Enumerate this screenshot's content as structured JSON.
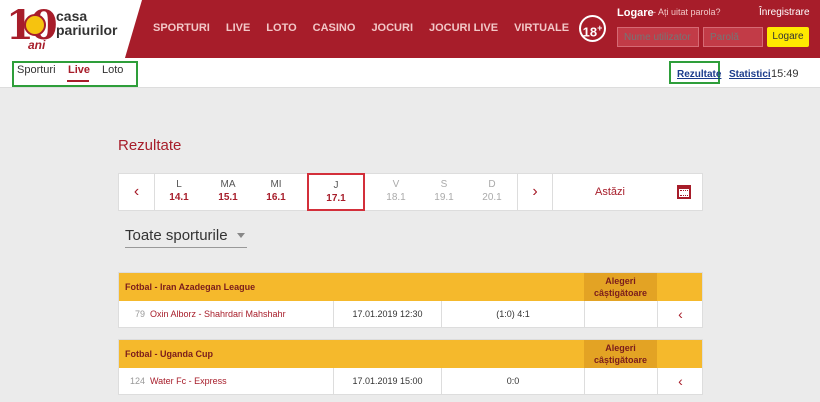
{
  "header": {
    "logo_number": "10",
    "logo_ani": "ani",
    "logo_text": "casa pariurilor",
    "nav": [
      "SPORTURI",
      "LIVE",
      "LOTO",
      "CASINO",
      "JOCURI",
      "JOCURI LIVE",
      "VIRTUALE"
    ],
    "age_badge": "18",
    "age_plus": "+",
    "login_title": "Logare",
    "forgot_password": "- Ați uitat parola?",
    "register": "Înregistrare",
    "username_placeholder": "Nume utilizator",
    "password_placeholder": "Parolă",
    "login_button": "Logare"
  },
  "subnav": {
    "tabs": [
      "Sporturi",
      "Live",
      "Loto"
    ],
    "active_tab": "Live",
    "results_link": "Rezultate",
    "stats_link": "Statistici",
    "time": "15:49"
  },
  "page": {
    "title": "Rezultate"
  },
  "datepicker": {
    "prev": "‹",
    "next": "›",
    "days": [
      {
        "name": "L",
        "date": "14.1"
      },
      {
        "name": "MA",
        "date": "15.1"
      },
      {
        "name": "MI",
        "date": "16.1"
      },
      {
        "name": "J",
        "date": "17.1"
      },
      {
        "name": "V",
        "date": "18.1"
      },
      {
        "name": "S",
        "date": "19.1"
      },
      {
        "name": "D",
        "date": "20.1"
      }
    ],
    "selected": "J",
    "today_label": "Astăzi",
    "calendar_icon": "calendar-icon"
  },
  "filter": {
    "sport_select": "Toate sporturile"
  },
  "leagues": [
    {
      "name": "Fotbal - Iran Azadegan League",
      "winners_header": "Alegeri câștigătoare",
      "rows": [
        {
          "id": "79",
          "match": "Oxin Alborz - Shahrdari Mahshahr",
          "date": "17.01.2019 12:30",
          "score": "(1:0) 4:1",
          "winners": ""
        }
      ]
    },
    {
      "name": "Fotbal - Uganda Cup",
      "winners_header": "Alegeri câștigătoare",
      "rows": [
        {
          "id": "124",
          "match": "Water Fc - Express",
          "date": "17.01.2019 15:00",
          "score": "0:0",
          "winners": ""
        }
      ]
    }
  ],
  "colors": {
    "brand_red": "#a71d2a",
    "league_header": "#f5b92c",
    "highlight_green": "#2e9e3a",
    "login_button": "#ffe900"
  }
}
